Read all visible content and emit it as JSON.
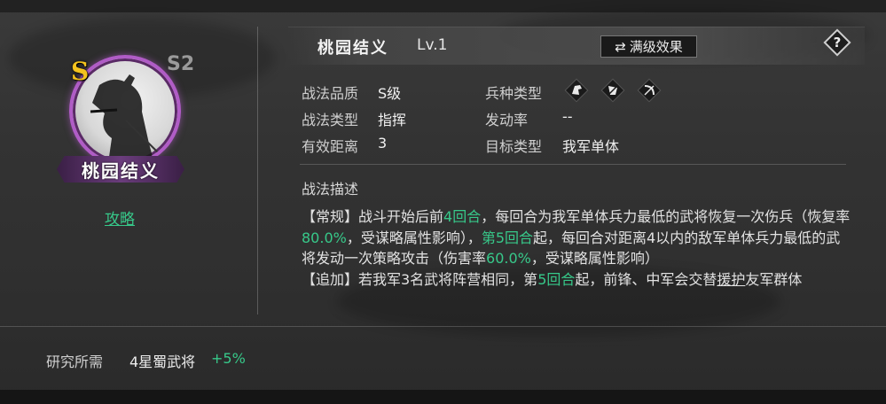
{
  "portrait": {
    "grade": "S",
    "season": "S2",
    "name": "桃园结义",
    "guide_link": "攻略"
  },
  "header": {
    "title": "桃园结义",
    "level": "Lv.1",
    "max_effect_label": "满级效果"
  },
  "info": {
    "quality_label": "战法品质",
    "quality_value": "S级",
    "type_label": "战法类型",
    "type_value": "指挥",
    "range_label": "有效距离",
    "range_value": "3",
    "troop_label": "兵种类型",
    "troop_icons": [
      "cavalry-icon",
      "shield-icon",
      "bow-icon"
    ],
    "trigger_label": "发动率",
    "trigger_value": "--",
    "target_label": "目标类型",
    "target_value": "我军单体"
  },
  "description": {
    "title": "战法描述",
    "p1": "【常规】战斗开始后前",
    "p2": "4回合",
    "p3": "，每回合为我军单体兵力最低的武将恢复一次伤兵（恢复率",
    "p4": "80.0%",
    "p5": "，受谋略属性影响），",
    "p6": "第5回合",
    "p7": "起，每回合对距离4以内的敌军单体兵力最低的武将发动一次策略攻击（伤害率",
    "p8": "60.0%",
    "p9": "，受谋略属性影响）",
    "p10": "【追加】若我军3名武将阵营相同，第",
    "p11": "5回合",
    "p12": "起，前锋、中军会交替",
    "p13": "援护",
    "p14": "友军群体"
  },
  "research": {
    "label": "研究所需",
    "value": "4星蜀武将",
    "bonus": "+5%"
  },
  "colors": {
    "accent_green": "#37c98a",
    "grade_gold": "#f3c21e",
    "frame_purple": "#b05cc6"
  }
}
